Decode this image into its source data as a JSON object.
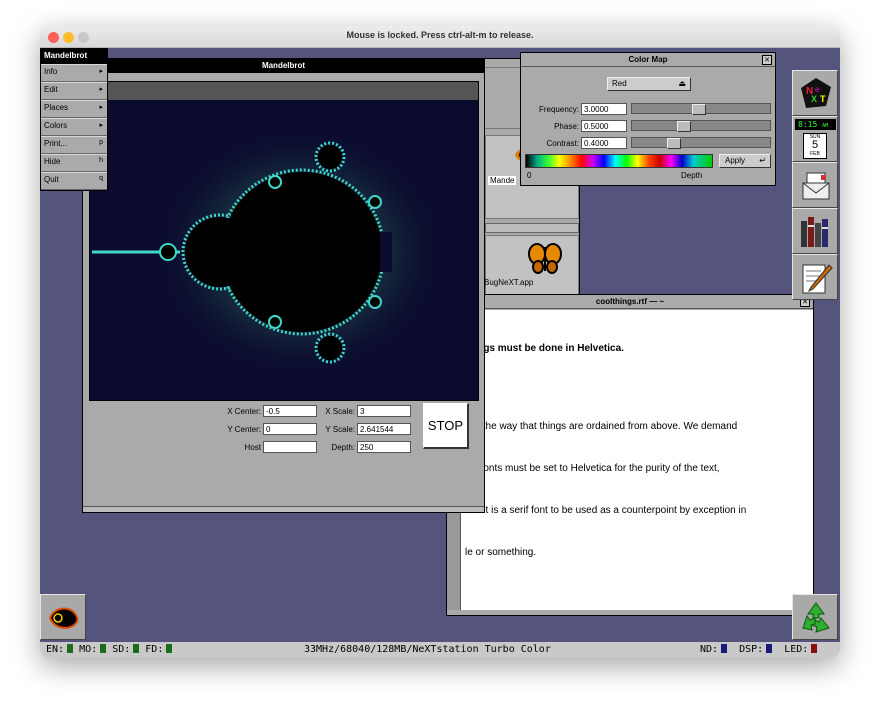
{
  "host": {
    "caption": "Mouse is locked. Press ctrl-alt-m to release."
  },
  "menu": {
    "title": "Mandelbrot",
    "items": [
      {
        "label": "Info",
        "key": "▸"
      },
      {
        "label": "Edit",
        "key": "▸"
      },
      {
        "label": "Places",
        "key": "▸"
      },
      {
        "label": "Colors",
        "key": "▸"
      },
      {
        "label": "Print...",
        "key": "p"
      },
      {
        "label": "Hide",
        "key": "h"
      },
      {
        "label": "Quit",
        "key": "q"
      }
    ]
  },
  "mandelbrot": {
    "title": "Mandelbrot",
    "x_center_label": "X Center:",
    "x_center": "-0.5",
    "y_center_label": "Y Center:",
    "y_center": "0",
    "host_label": "Host",
    "host": "",
    "x_scale_label": "X Scale:",
    "x_scale": "3",
    "y_scale_label": "Y Scale:",
    "y_scale": "2.641544",
    "depth_label": "Depth:",
    "depth": "250",
    "stop_label": "STOP"
  },
  "colormap": {
    "title": "Color Map",
    "popup": "Red",
    "frequency_label": "Frequency:",
    "frequency": "3.0000",
    "frequency_level": 0.48,
    "phase_label": "Phase:",
    "phase": "0.5000",
    "phase_level": 0.36,
    "contrast_label": "Contrast:",
    "contrast": "0.4000",
    "contrast_level": 0.28,
    "apply_label": "Apply",
    "scale_min": "0",
    "scale_label": "Depth"
  },
  "viewer": {
    "item1_label": "Mande",
    "item2_label": "BugNeXT.app"
  },
  "editor": {
    "title": "coolthings.rtf — ~",
    "heading": "things must be done in Helvetica.",
    "lines": [
      "s is the way that things are ordained from above. We demand",
      " all fonts must be set to Helvetica for the purity of the text,",
      "ess it is a serif font to be used as a counterpoint by exception in",
      "le or something."
    ]
  },
  "dock": {
    "clock_time": "8:15",
    "clock_ampm": "AM",
    "clock_day": "SUN",
    "clock_date": "5",
    "clock_month": "FEB"
  },
  "status": {
    "en": "EN:",
    "mo": "MO:",
    "sd": "SD:",
    "fd": "FD:",
    "machine": "33MHz/68040/128MB/NeXTstation Turbo Color",
    "nd": "ND:",
    "dsp": "DSP:",
    "led": "LED:"
  },
  "colors": {
    "desktop": "#55547d",
    "fractal_bg": "#0b0b2e",
    "led_green": "#1d6b1d",
    "led_blue": "#1a1a7a",
    "led_red": "#8a1010"
  }
}
